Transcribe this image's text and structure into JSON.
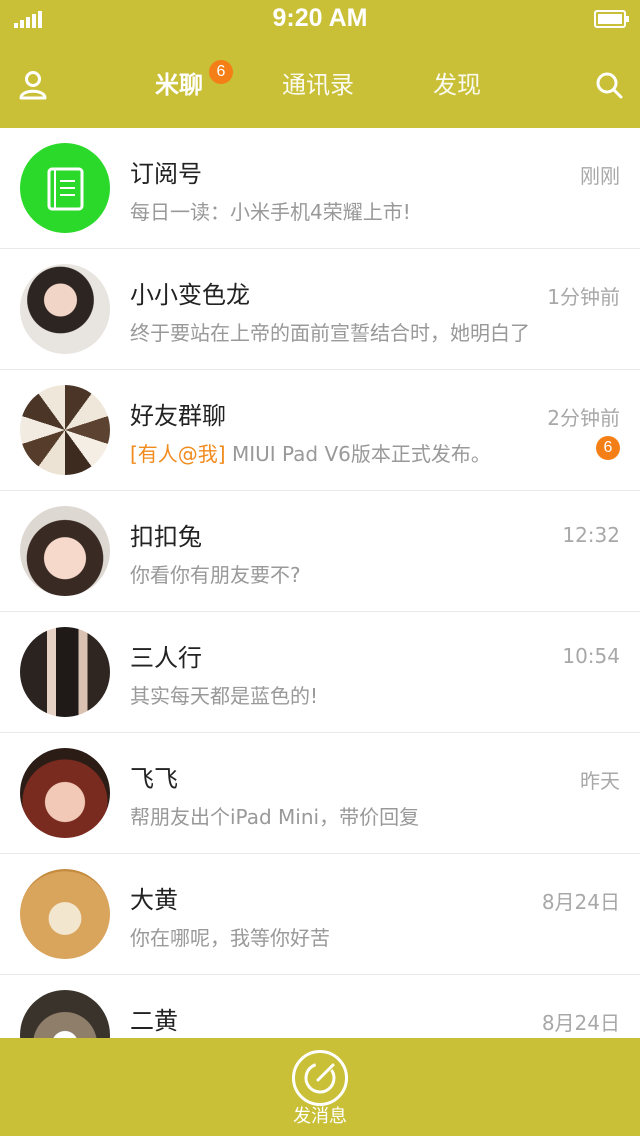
{
  "status": {
    "time": "9:20 AM"
  },
  "nav": {
    "tabs": [
      {
        "label": "米聊",
        "badge": "6",
        "active": true
      },
      {
        "label": "通讯录"
      },
      {
        "label": "发现"
      }
    ],
    "left_icon": "user-icon",
    "right_icon": "search-icon"
  },
  "colors": {
    "brand": "#c9c037",
    "badge": "#f47f16",
    "mention": "#f28b1e",
    "subscription": "#2bd92b"
  },
  "conversations": [
    {
      "name": "订阅号",
      "preview": "每日一读：小米手机4荣耀上市!",
      "time": "刚刚",
      "avatar": "book-icon"
    },
    {
      "name": "小小变色龙",
      "preview": "终于要站在上帝的面前宣誓结合时，她明白了",
      "time": "1分钟前",
      "avatar": "avatar-photo"
    },
    {
      "name": "好友群聊",
      "mention": "[有人@我]",
      "preview": " MIUI Pad V6版本正式发布。",
      "time": "2分钟前",
      "badge": "6",
      "avatar": "avatar-photo"
    },
    {
      "name": "扣扣兔",
      "preview": "你看你有朋友要不?",
      "time": "12:32",
      "avatar": "avatar-photo"
    },
    {
      "name": "三人行",
      "preview": "其实每天都是蓝色的!",
      "time": "10:54",
      "avatar": "avatar-photo"
    },
    {
      "name": "飞飞",
      "preview": "帮朋友出个iPad Mini，带价回复",
      "time": "昨天",
      "avatar": "avatar-photo"
    },
    {
      "name": "大黄",
      "preview": "你在哪呢，我等你好苦",
      "time": "8月24日",
      "avatar": "avatar-photo"
    },
    {
      "name": "二黄",
      "preview": "",
      "time": "8月24日",
      "avatar": "avatar-photo"
    }
  ],
  "bottom": {
    "compose_label": "发消息"
  }
}
